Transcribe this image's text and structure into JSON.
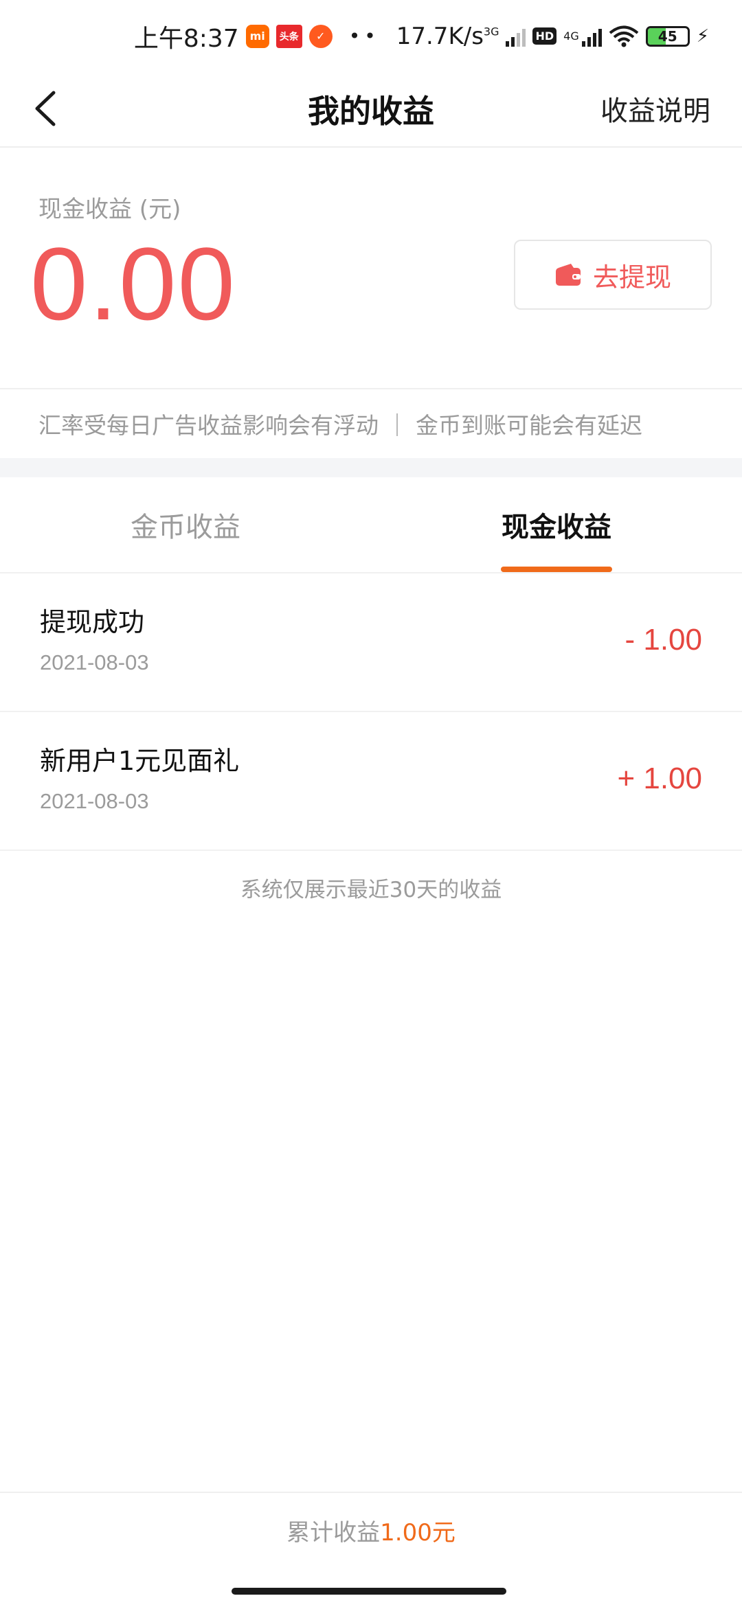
{
  "status_bar": {
    "time": "上午8:37",
    "app_icons": [
      "mi-app-icon",
      "toutiao-app-icon",
      "red-app-icon"
    ],
    "app_labels": {
      "mi": "mi",
      "toutiao": "头条"
    },
    "more": "••",
    "speed": "17.7K/s",
    "net1": "3G",
    "hd": "HD",
    "net2": "4G",
    "battery": "45",
    "battery_level": 0.45,
    "charging": true
  },
  "header": {
    "title": "我的收益",
    "right_link": "收益说明"
  },
  "balance": {
    "label": "现金收益 (元)",
    "amount": "0.00",
    "withdraw_label": "去提现"
  },
  "notice": "汇率受每日广告收益影响会有浮动 ｜ 金币到账可能会有延迟",
  "tabs": [
    {
      "label": "金币收益",
      "active": false
    },
    {
      "label": "现金收益",
      "active": true
    }
  ],
  "records": [
    {
      "title": "提现成功",
      "date": "2021-08-03",
      "amount": "- 1.00"
    },
    {
      "title": "新用户1元见面礼",
      "date": "2021-08-03",
      "amount": "+ 1.00"
    }
  ],
  "footnote": "系统仅展示最近30天的收益",
  "total": {
    "label": "累计收益",
    "value": "1.00元"
  },
  "colors": {
    "amount_red": "#f05a5a",
    "accent_orange": "#f06a1a",
    "muted_gray": "#9b9b9b",
    "battery_green": "#5ad15a"
  }
}
